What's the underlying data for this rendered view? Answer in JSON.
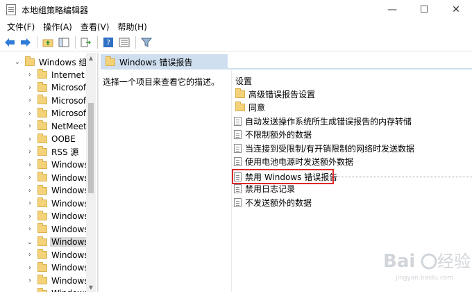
{
  "window": {
    "title": "本地组策略编辑器",
    "controls": [
      "—",
      "☐",
      "✕"
    ]
  },
  "menu": [
    "文件(F)",
    "操作(A)",
    "查看(V)",
    "帮助(H)"
  ],
  "toolbar": {
    "buttons": [
      "back-arrow-icon",
      "forward-arrow-icon",
      "up-folder-icon",
      "show-hide-tree-icon",
      "export-list-icon",
      "help-icon",
      "properties-icon",
      "filter-icon"
    ]
  },
  "tree": {
    "items": [
      {
        "label": "Windows 组件",
        "expanded": true,
        "selected": false
      },
      {
        "label": "Internet E",
        "expanded": false,
        "selected": false
      },
      {
        "label": "Microsoft",
        "expanded": false,
        "selected": false
      },
      {
        "label": "Microsoft",
        "expanded": false,
        "selected": false
      },
      {
        "label": "Microsoft",
        "expanded": false,
        "selected": false
      },
      {
        "label": "NetMeetir",
        "expanded": false,
        "selected": false
      },
      {
        "label": "OOBE",
        "expanded": false,
        "selected": false
      },
      {
        "label": "RSS 源",
        "expanded": false,
        "selected": false
      },
      {
        "label": "Windows",
        "expanded": false,
        "selected": false
      },
      {
        "label": "Windows",
        "expanded": false,
        "selected": false
      },
      {
        "label": "Windows",
        "expanded": false,
        "selected": false
      },
      {
        "label": "Windows",
        "expanded": false,
        "selected": false
      },
      {
        "label": "Windows",
        "expanded": false,
        "selected": false
      },
      {
        "label": "Windows",
        "expanded": false,
        "selected": false
      },
      {
        "label": "Windows",
        "expanded": true,
        "selected": true
      },
      {
        "label": "Windows",
        "expanded": false,
        "selected": false
      },
      {
        "label": "Windows",
        "expanded": false,
        "selected": false
      },
      {
        "label": "Windows",
        "expanded": false,
        "selected": false
      },
      {
        "label": "Windows",
        "expanded": false,
        "selected": false
      }
    ]
  },
  "right": {
    "header": "Windows 错误报告",
    "description": "选择一个项目来查看它的描述。",
    "column_header": "设置",
    "settings": [
      {
        "label": "高级错误报告设置",
        "type": "folder"
      },
      {
        "label": "同意",
        "type": "folder"
      },
      {
        "label": "自动发送操作系统所生成错误报告的内存转储",
        "type": "policy"
      },
      {
        "label": "不限制额外的数据",
        "type": "policy"
      },
      {
        "label": "当连接到受限制/有开销限制的网络时发送数据",
        "type": "policy"
      },
      {
        "label": "使用电池电源时发送额外数据",
        "type": "policy"
      },
      {
        "label": "禁用 Windows 错误报告",
        "type": "policy",
        "highlighted": true
      },
      {
        "label": "禁用日志记录",
        "type": "policy"
      },
      {
        "label": "不发送额外的数据",
        "type": "policy"
      }
    ]
  },
  "colors": {
    "header_band": "#cfdff0",
    "highlight_border": "#e0282a",
    "folder": "#f3d27a"
  },
  "watermark": "Baidu 经验"
}
